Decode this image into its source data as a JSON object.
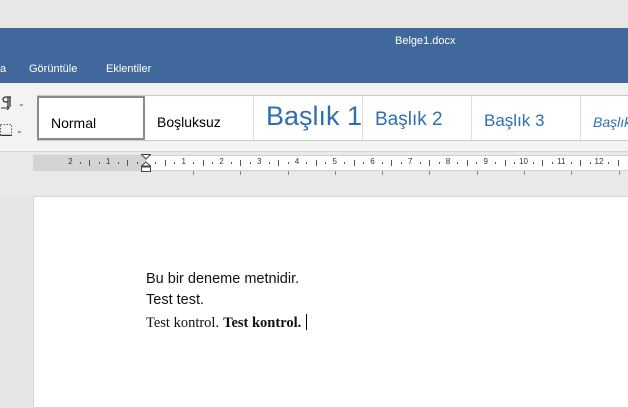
{
  "window": {
    "title": "Belge1.docx"
  },
  "menubar": {
    "items": [
      "a",
      "Görüntüle",
      "Eklentiler"
    ]
  },
  "ribbon": {
    "tools": [
      {
        "icon": "paragraph-marks-icon"
      },
      {
        "icon": "borders-icon"
      }
    ]
  },
  "styles": [
    "Normal",
    "Boşluksuz",
    "Başlık 1",
    "Başlık 2",
    "Başlık 3",
    "Başlık"
  ],
  "ruler": {
    "numbers": [
      "2",
      "1",
      "1",
      "2",
      "3",
      "4",
      "5",
      "6",
      "7",
      "8",
      "9",
      "10",
      "11",
      "12"
    ]
  },
  "document": {
    "line1": "Bu bir deneme metnidir.",
    "line2": "Test test.",
    "line3_plain": "Test kontrol.",
    "line3_bold": "Test kontrol."
  }
}
